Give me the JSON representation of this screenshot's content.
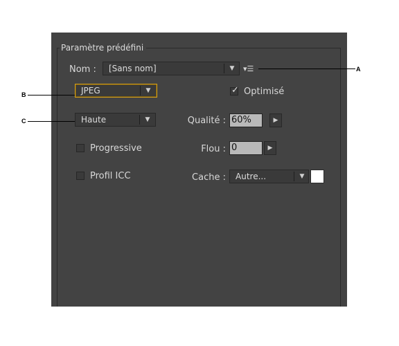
{
  "preset_group": {
    "title": "Paramètre prédéfini"
  },
  "name": {
    "label": "Nom :",
    "value": "[Sans nom]",
    "menu_icon": "options-menu-icon"
  },
  "format": {
    "value": "JPEG"
  },
  "optimized": {
    "label": "Optimisé",
    "checked": true
  },
  "quality_preset": {
    "value": "Haute"
  },
  "quality": {
    "label": "Qualité :",
    "value": "60%"
  },
  "progressive": {
    "label": "Progressive",
    "checked": false
  },
  "blur": {
    "label": "Flou :",
    "value": "0"
  },
  "icc_profile": {
    "label": "Profil ICC",
    "checked": false
  },
  "matte": {
    "label": "Cache :",
    "value": "Autre...",
    "swatch_color": "#ffffff"
  },
  "callouts": {
    "a": "A",
    "b": "B",
    "c": "C"
  },
  "colors": {
    "panel_bg": "#434343",
    "focus_ring": "#d8a21a"
  }
}
